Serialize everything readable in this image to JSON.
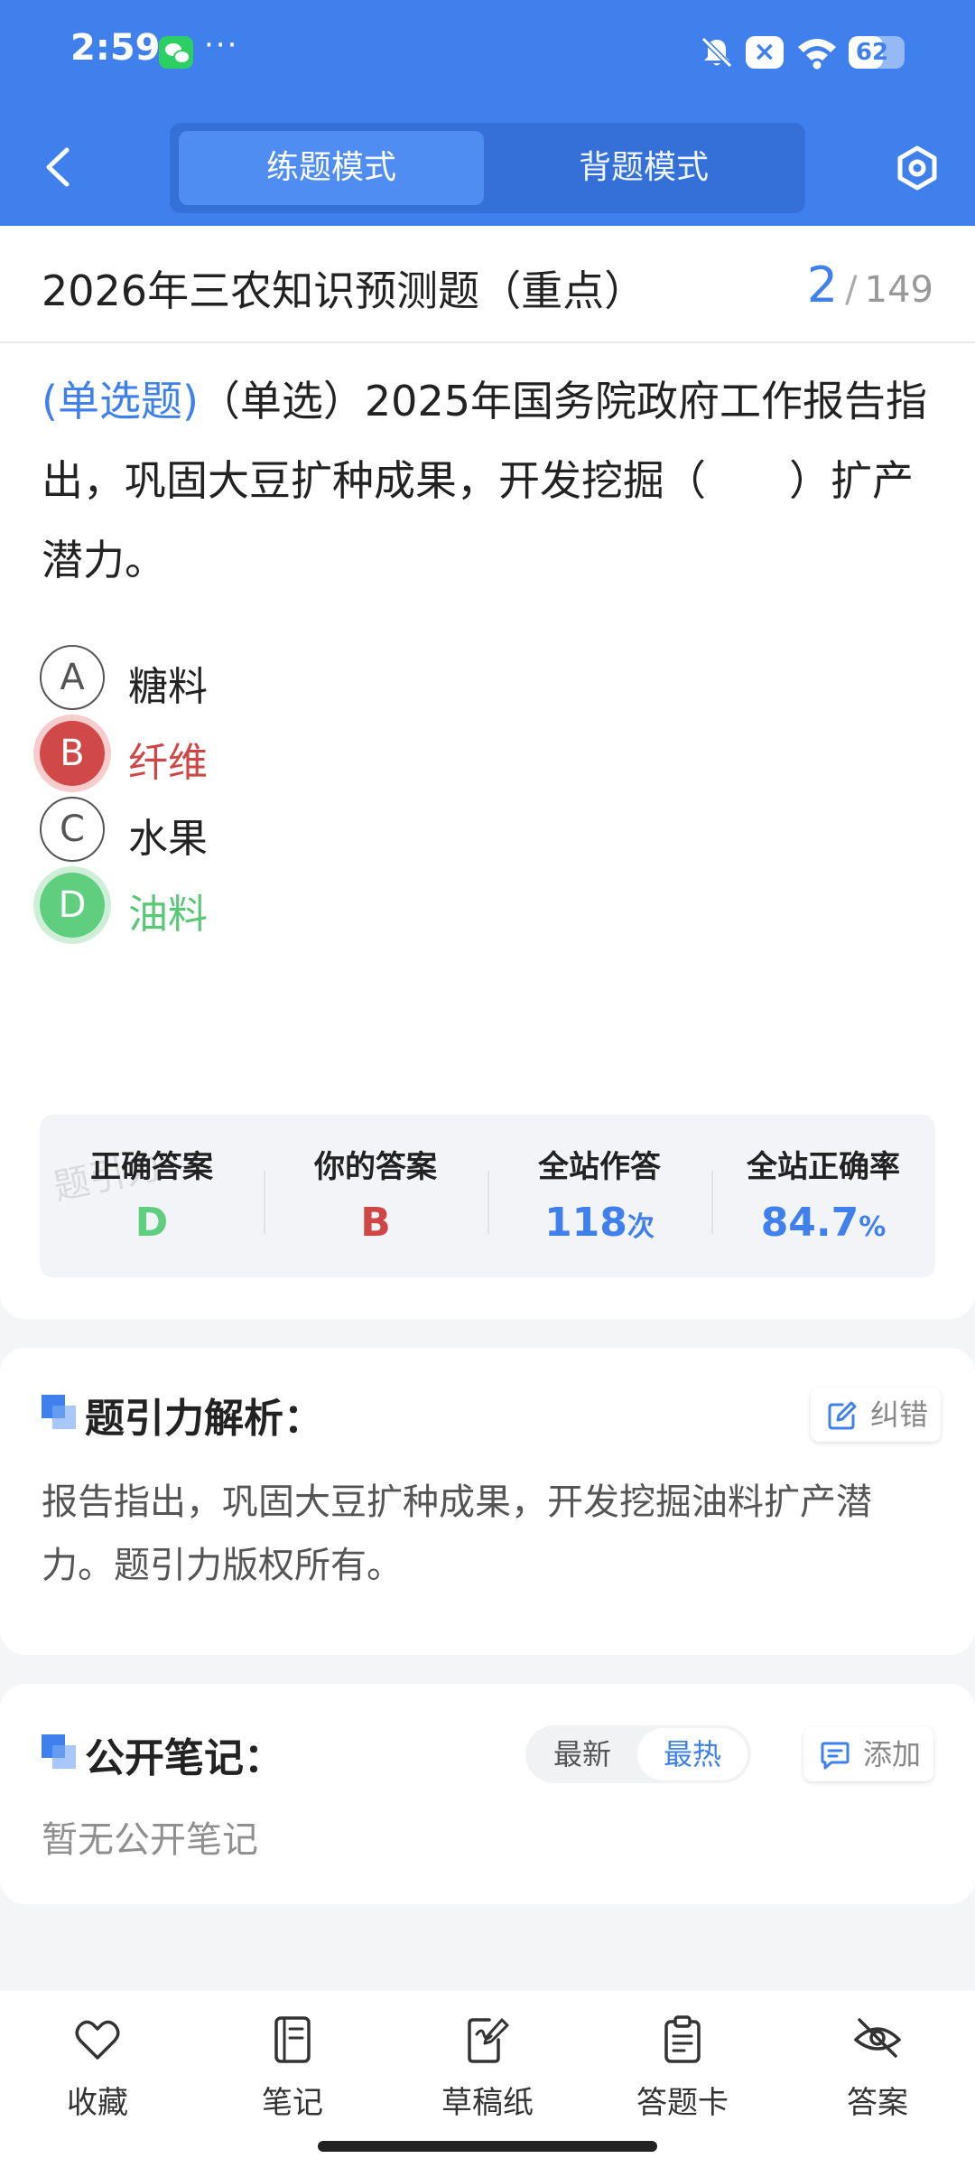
{
  "status_bar": {
    "time": "2:59",
    "more": "···",
    "battery": "62",
    "battery_level": 0.62
  },
  "header": {
    "tabs": [
      {
        "label": "练题模式",
        "active": true
      },
      {
        "label": "背题模式",
        "active": false
      }
    ]
  },
  "exam": {
    "title": "2026年三农知识预测题（重点）",
    "current": "2",
    "separator": "/",
    "total": "149"
  },
  "question": {
    "type_label": "(单选题)",
    "text": "（单选）2025年国务院政府工作报告指出，巩固大豆扩种成果，开发挖掘（　　）扩产潜力。",
    "options": [
      {
        "letter": "A",
        "text": "糖料",
        "state": "normal"
      },
      {
        "letter": "B",
        "text": "纤维",
        "state": "wrong"
      },
      {
        "letter": "C",
        "text": "水果",
        "state": "normal"
      },
      {
        "letter": "D",
        "text": "油料",
        "state": "correct"
      }
    ]
  },
  "stats": {
    "watermark": "题引力",
    "correct_label": "正确答案",
    "correct_value": "D",
    "yours_label": "你的答案",
    "yours_value": "B",
    "count_label": "全站作答",
    "count_value": "118",
    "count_unit": "次",
    "rate_label": "全站正确率",
    "rate_value": "84.7",
    "rate_unit": "%"
  },
  "analysis": {
    "title": "题引力解析：",
    "report_button": "纠错",
    "text": "报告指出，巩固大豆扩种成果，开发挖掘油料扩产潜力。题引力版权所有。"
  },
  "notes": {
    "title": "公开笔记：",
    "sort_latest": "最新",
    "sort_hot": "最热",
    "add_button": "添加",
    "empty": "暂无公开笔记"
  },
  "bottom_nav": [
    {
      "label": "收藏",
      "icon": "heart-icon"
    },
    {
      "label": "笔记",
      "icon": "notebook-icon"
    },
    {
      "label": "草稿纸",
      "icon": "draft-icon"
    },
    {
      "label": "答题卡",
      "icon": "clipboard-icon"
    },
    {
      "label": "答案",
      "icon": "eye-off-icon"
    }
  ],
  "colors": {
    "primary": "#3f80ec",
    "wrong": "#d14848",
    "correct": "#5fcf7f"
  }
}
